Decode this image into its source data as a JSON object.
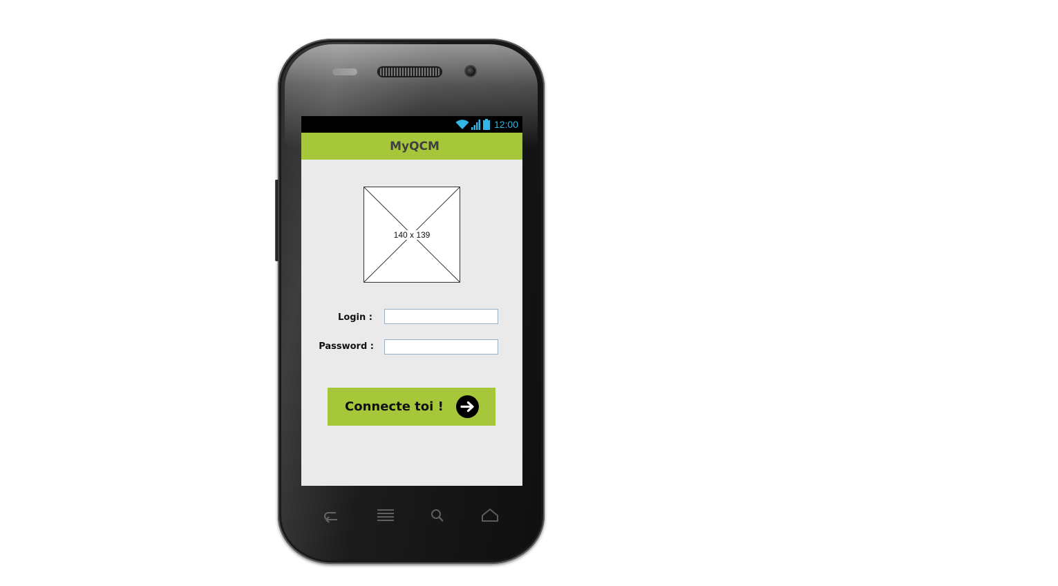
{
  "status_bar": {
    "time": "12:00",
    "icons": [
      "wifi-icon",
      "signal-icon",
      "battery-icon"
    ],
    "accent_color": "#33b5e5"
  },
  "app_bar": {
    "title": "MyQCM",
    "color": "#a5c739"
  },
  "image_placeholder": {
    "size_label": "140 x 139"
  },
  "form": {
    "login_label": "Login :",
    "login_value": "",
    "password_label": "Password :",
    "password_value": ""
  },
  "connect_button": {
    "label": "Connecte toi !",
    "icon": "arrow-right-circle-icon"
  },
  "nav_keys": [
    "back-icon",
    "menu-icon",
    "search-icon",
    "home-icon"
  ]
}
